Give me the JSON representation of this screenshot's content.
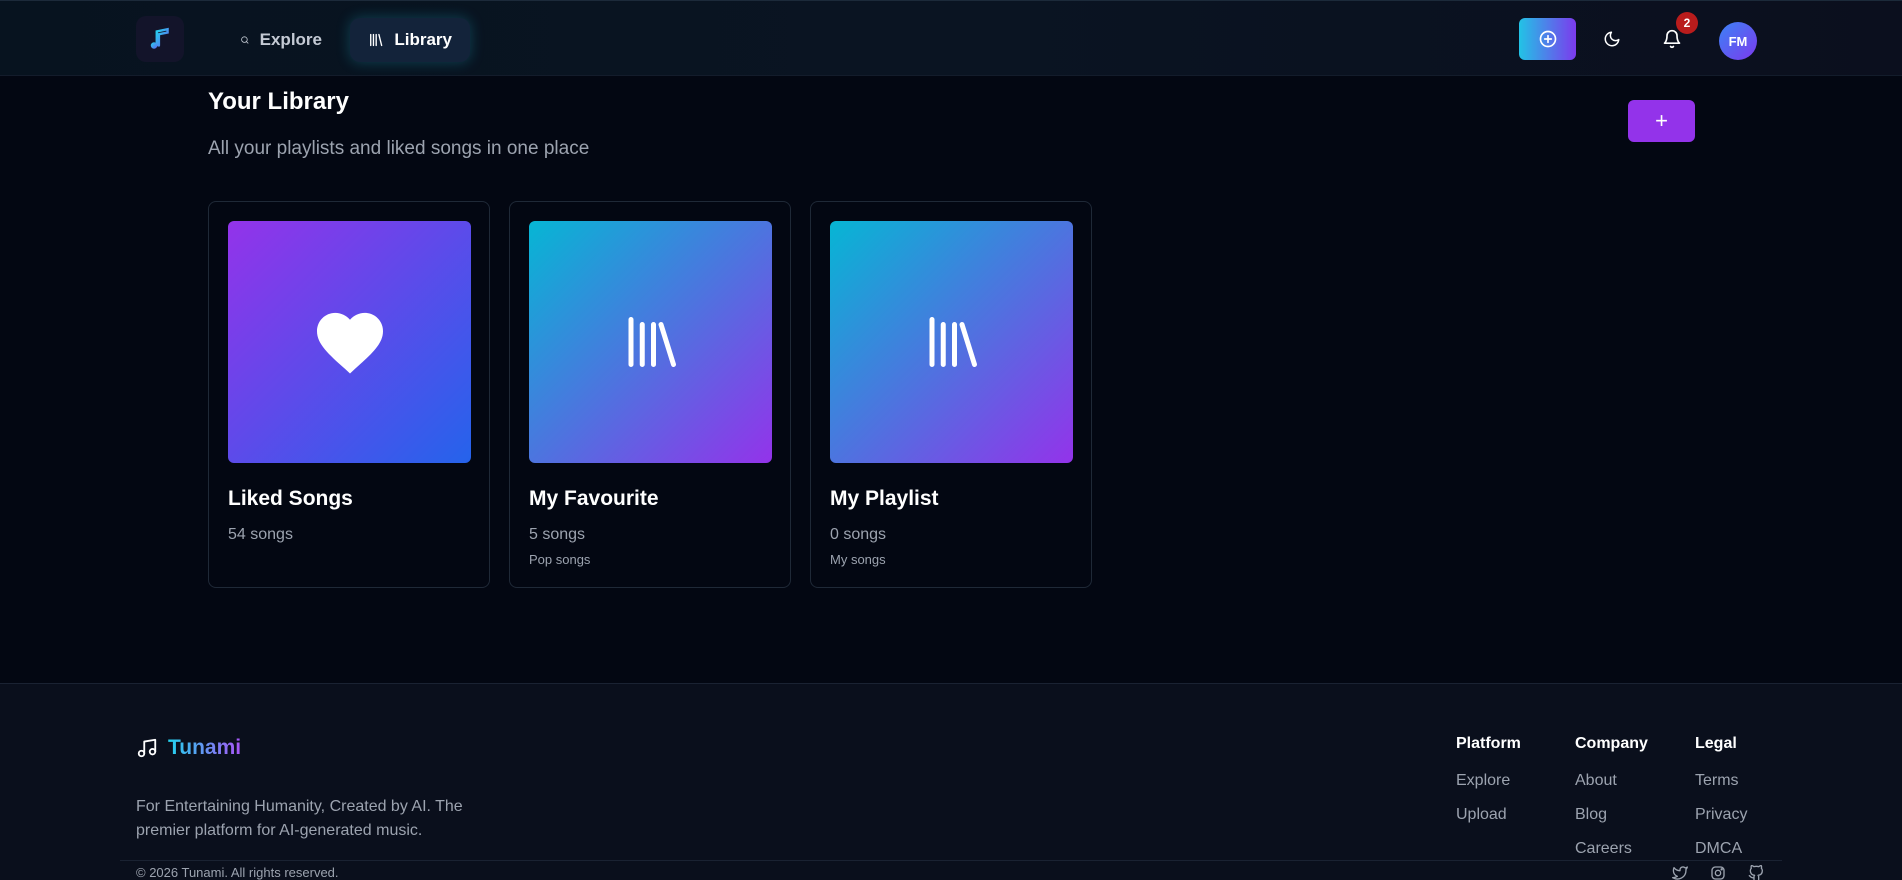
{
  "header": {
    "nav": [
      {
        "label": "Explore",
        "icon": "search-icon"
      },
      {
        "label": "Library",
        "icon": "library-icon",
        "active": true
      }
    ],
    "notification_count": "2",
    "avatar_initials": "FM"
  },
  "library": {
    "title": "Your Library",
    "subtitle": "All your playlists and liked songs in one place",
    "add_label": "+",
    "cards": [
      {
        "title": "Liked Songs",
        "count": "54 songs",
        "description": "",
        "icon": "heart-icon"
      },
      {
        "title": "My Favourite",
        "count": "5 songs",
        "description": "Pop songs",
        "icon": "library-icon"
      },
      {
        "title": "My Playlist",
        "count": "0 songs",
        "description": "My songs",
        "icon": "library-icon"
      }
    ]
  },
  "footer": {
    "brand": "Tunami",
    "tagline": "For Entertaining Humanity, Created by AI. The premier platform for AI-generated music.",
    "columns": [
      {
        "title": "Platform",
        "links": [
          "Explore",
          "Upload"
        ]
      },
      {
        "title": "Company",
        "links": [
          "About",
          "Blog",
          "Careers"
        ]
      },
      {
        "title": "Legal",
        "links": [
          "Terms",
          "Privacy",
          "DMCA"
        ]
      }
    ],
    "copyright": "© 2026 Tunami. All rights reserved.",
    "social": [
      "twitter-icon",
      "instagram-icon",
      "github-icon"
    ]
  },
  "colors": {
    "background": "#030712",
    "accent_purple": "#9333ea",
    "accent_cyan": "#22d3ee",
    "badge_red": "#b91c1c"
  }
}
